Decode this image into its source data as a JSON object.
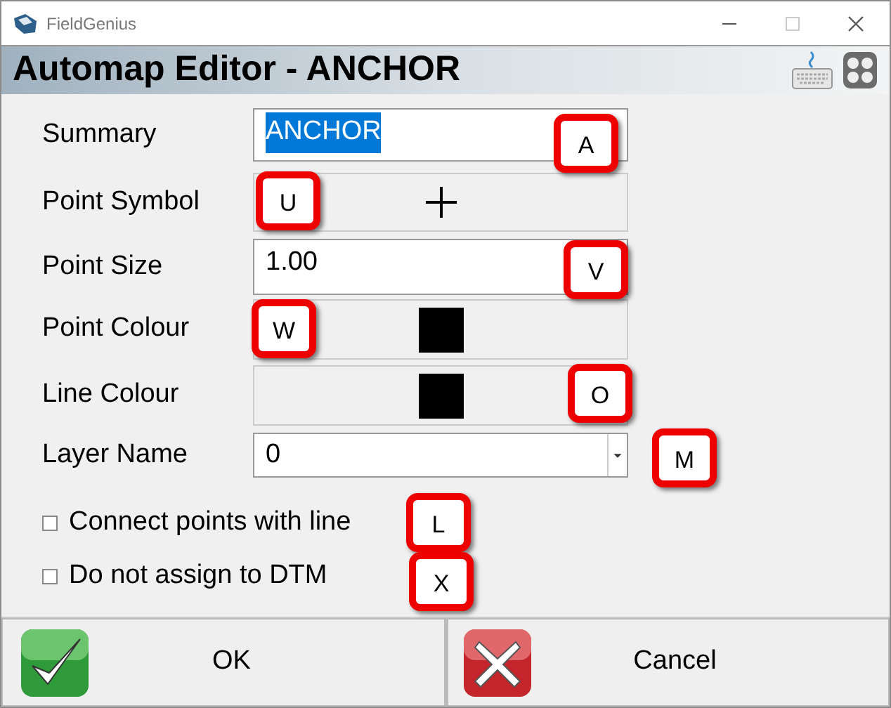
{
  "window": {
    "title": "FieldGenius"
  },
  "header": {
    "title": "Automap Editor - ANCHOR"
  },
  "fields": [
    {
      "kind": "text",
      "label": "Summary",
      "value": "ANCHOR",
      "text_selected": true,
      "hotkey": "A"
    },
    {
      "kind": "symbol",
      "label": "Point Symbol",
      "hotkey": "U"
    },
    {
      "kind": "text",
      "label": "Point Size",
      "value": "1.00",
      "text_selected": false,
      "hotkey": "V"
    },
    {
      "kind": "color",
      "label": "Point Colour",
      "color": "#000000",
      "hotkey": "W"
    },
    {
      "kind": "color",
      "label": "Line Colour",
      "color": "#000000",
      "hotkey": "O"
    },
    {
      "kind": "dropdown",
      "label": "Layer Name",
      "value": "0",
      "hotkey": "M"
    }
  ],
  "checkboxes": [
    {
      "label": "Connect points with line",
      "checked": false,
      "hotkey": "L"
    },
    {
      "label": "Do not assign to DTM",
      "checked": false,
      "hotkey": "X"
    }
  ],
  "buttons": [
    {
      "kind": "ok",
      "label": "OK"
    },
    {
      "kind": "cancel",
      "label": "Cancel"
    }
  ]
}
